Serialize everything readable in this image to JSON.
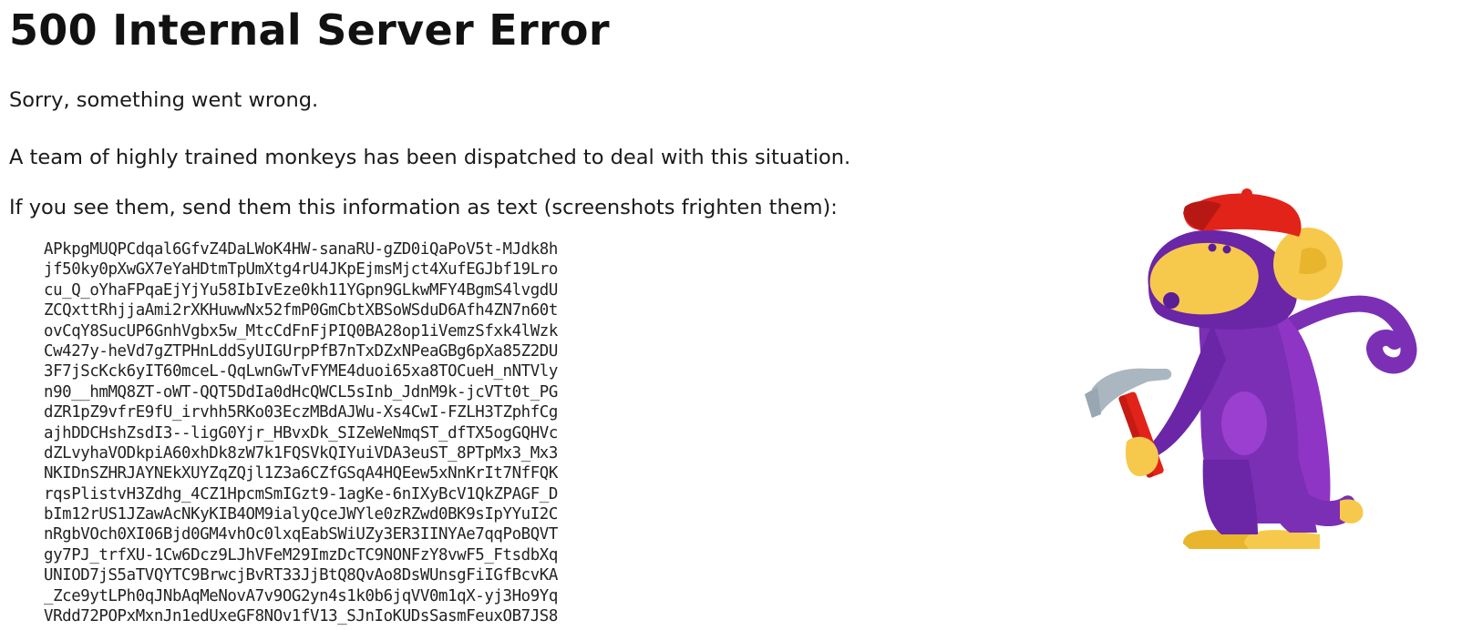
{
  "error": {
    "title": "500 Internal Server Error",
    "sorry": "Sorry, something went wrong.",
    "monkeys": "A team of highly trained monkeys has been dispatched to deal with this situation.",
    "instructions": "If you see them, send them this information as text (screenshots frighten them):"
  },
  "debug_info_lines": [
    "APkpgMUQPCdqal6GfvZ4DaLWoK4HW-sanaRU-gZD0iQaPoV5t-MJdk8h",
    "jf50ky0pXwGX7eYaHDtmTpUmXtg4rU4JKpEjmsMjct4XufEGJbf19Lro",
    "cu_Q_oYhaFPqaEjYjYu58IbIvEze0kh11YGpn9GLkwMFY4BgmS4lvgdU",
    "ZCQxttRhjjaAmi2rXKHuwwNx52fmP0GmCbtXBSoWSduD6Afh4ZN7n60t",
    "ovCqY8SucUP6GnhVgbx5w_MtcCdFnFjPIQ0BA28op1iVemzSfxk4lWzk",
    "Cw427y-heVd7gZTPHnLddSyUIGUrpPfB7nTxDZxNPeaGBg6pXa85Z2DU",
    "3F7jScKck6yIT60mceL-QqLwnGwTvFYME4duoi65xa8TOCueH_nNTVly",
    "n90__hmMQ8ZT-oWT-QQT5DdIa0dHcQWCL5sInb_JdnM9k-jcVTt0t_PG",
    "dZR1pZ9vfrE9fU_irvhh5RKo03EczMBdAJWu-Xs4CwI-FZLH3TZphfCg",
    "ajhDDCHshZsdI3--ligG0Yjr_HBvxDk_SIZeWeNmqST_dfTX5ogGQHVc",
    "dZLvyhaVODkpiA60xhDk8zW7k1FQSVkQIYuiVDA3euST_8PTpMx3_Mx3",
    "NKIDnSZHRJAYNEkXUYZqZQjl1Z3a6CZfGSqA4HQEew5xNnKrIt7NfFQK",
    "rqsPlistvH3Zdhg_4CZ1HpcmSmIGzt9-1agKe-6nIXyBcV1QkZPAGF_D",
    "bIm12rUS1JZawAcNKyKIB4OM9ialyQceJWYle0zRZwd0BK9sIpYYuI2C",
    "nRgbVOch0XI06Bjd0GM4vhOc0lxqEabSWiUZy3ER3IINYAe7qqPoBQVT",
    "gy7PJ_trfXU-1Cw6Dcz9LJhVFeM29ImzDcTC9NONFzY8vwF5_FtsdbXq",
    "UNIOD7jS5aTVQYTC9BrwcjBvRT33JjBtQ8QvAo8DsWUnsgFiIGfBcvKA",
    "_Zce9ytLPh0qJNbAqMeNovA7v9OG2yn4s1k0b6jqVV0m1qX-yj3Ho9Yq",
    "VRdd72POPxMxnJn1edUxeGF8NOv1fV13_SJnIoKUDsSasmFeuxOB7JS8"
  ],
  "colors": {
    "monkey_purple": "#7b2fb5",
    "monkey_dark_purple": "#5b1e96",
    "monkey_face": "#f6c94c",
    "cap_red": "#e2231a",
    "hammer_red": "#e2231a",
    "hammer_head": "#aab7c0"
  }
}
